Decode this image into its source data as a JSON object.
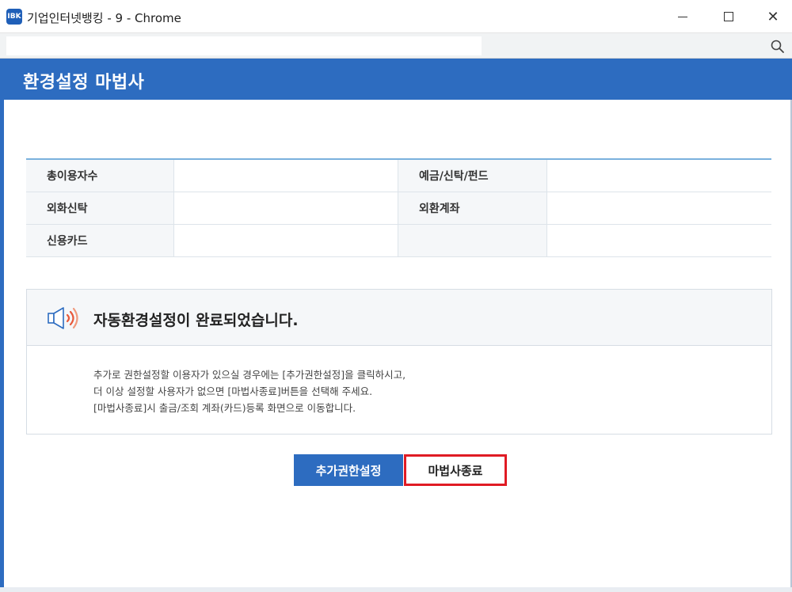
{
  "window": {
    "title": "기업인터넷뱅킹 - 9 - Chrome",
    "logo_text": "IBK",
    "minimize_icon": "minimize-icon",
    "maximize_icon": "maximize-icon",
    "close_icon": "close-icon",
    "close_glyph": "✕"
  },
  "addressbar": {
    "url": "",
    "zoom_icon": "zoom-icon"
  },
  "dialog": {
    "title": "환경설정 마법사"
  },
  "table": {
    "rows": [
      {
        "label1": "총이용자수",
        "value1": "",
        "label2": "예금/신탁/펀드",
        "value2": ""
      },
      {
        "label1": "외화신탁",
        "value1": "",
        "label2": "외환계좌",
        "value2": ""
      },
      {
        "label1": "신용카드",
        "value1": "",
        "label2": "",
        "value2": ""
      }
    ]
  },
  "message": {
    "icon": "speaker-icon",
    "title": "자동환경설정이 완료되었습니다.",
    "lines": [
      "추가로 권한설정할 이용자가 있으실 경우에는 [추가권한설정]을 클릭하시고,",
      "더 이상 설정할 사용자가 없으면 [마법사종료]버튼을 선택해 주세요.",
      "[마법사종료]시 출금/조회 계좌(카드)등록 화면으로 이동합니다."
    ]
  },
  "buttons": {
    "add_permission": "추가권한설정",
    "finish_wizard": "마법사종료"
  },
  "colors": {
    "brand_blue": "#2d6cc0",
    "highlight_red": "#e01b24"
  }
}
